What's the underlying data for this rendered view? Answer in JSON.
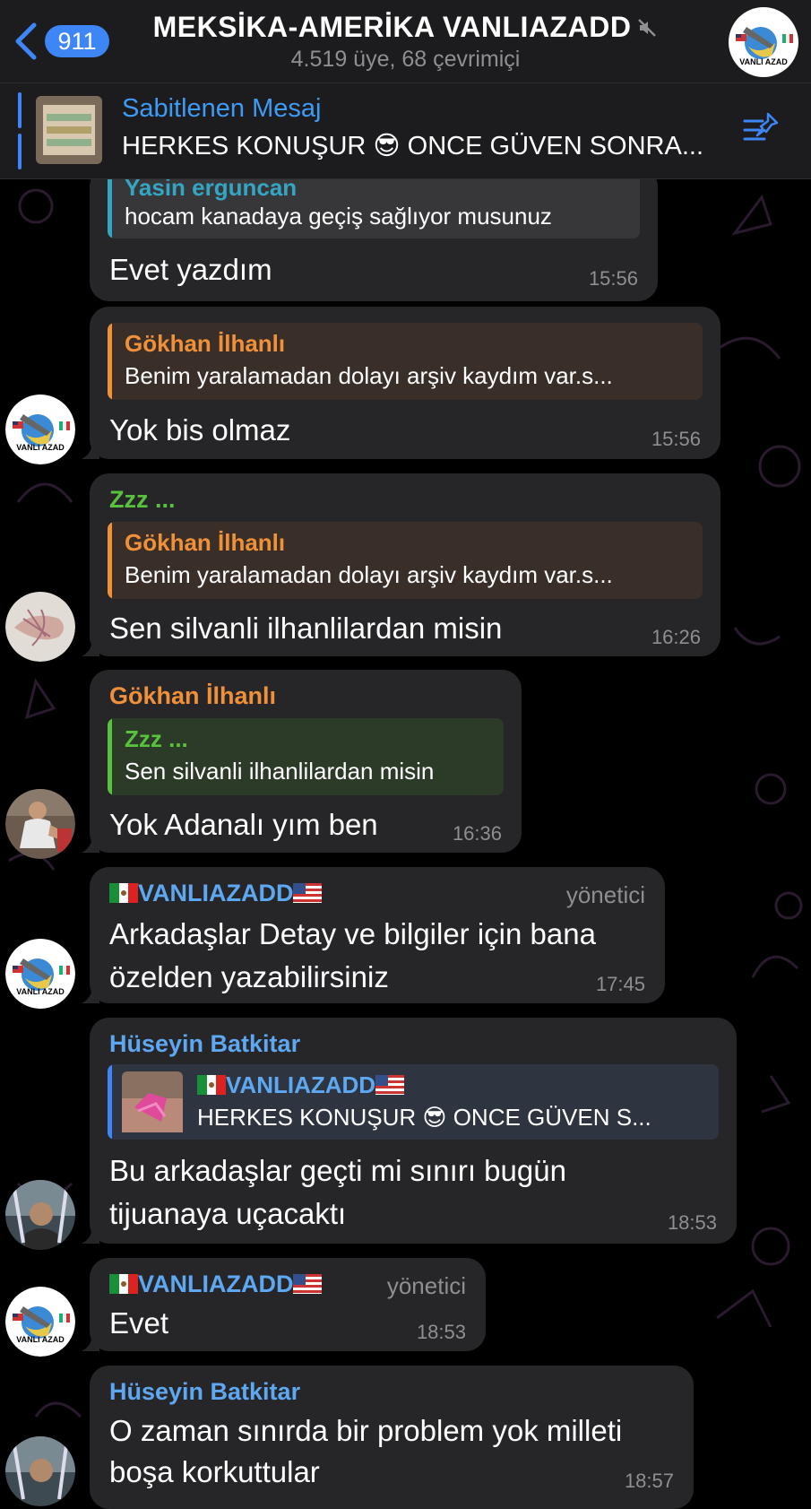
{
  "header": {
    "back_count": "911",
    "title": "MEKSİKA-AMERİKA VANLIAZADD",
    "subtitle": "4.519 üye, 68 çevrimiçi",
    "avatar_caption": "VANLI AZAD"
  },
  "pinned": {
    "title": "Sabitlenen Mesaj",
    "text": "HERKES KONUŞUR 😎 ONCE GÜVEN SONRA..."
  },
  "avatar_caption": "VANLI AZAD",
  "messages": [
    {
      "reply_name": "Yasin erguncan",
      "reply_text": "hocam kanadaya geçiş sağlıyor musunuz",
      "text": "Evet yazdım",
      "time": "15:56"
    },
    {
      "reply_name": "Gökhan İlhanlı",
      "reply_text": "Benim yaralamadan dolayı arşiv kaydım var.s...",
      "text": "Yok bis olmaz",
      "time": "15:56"
    },
    {
      "sender": "Zzz ...",
      "reply_name": "Gökhan İlhanlı",
      "reply_text": "Benim yaralamadan dolayı arşiv kaydım var.s...",
      "text": "Sen silvanli ilhanlilardan misin",
      "time": "16:26"
    },
    {
      "sender": "Gökhan İlhanlı",
      "reply_name": "Zzz ...",
      "reply_text": "Sen silvanli ilhanlilardan misin",
      "text": "Yok Adanalı yım ben",
      "time": "16:36"
    },
    {
      "sender": "VANLIAZADD",
      "role": "yönetici",
      "line1": "Arkadaşlar Detay ve bilgiler için bana",
      "line2": "özelden yazabilirsiniz",
      "time": "17:45"
    },
    {
      "sender": "Hüseyin Batkitar",
      "reply_name": "VANLIAZADD",
      "reply_text": "HERKES KONUŞUR 😎 ONCE GÜVEN S...",
      "line1": "Bu arkadaşlar geçti mi sınırı bugün",
      "line2": "tijuanaya uçacaktı",
      "time": "18:53"
    },
    {
      "sender": "VANLIAZADD",
      "role": "yönetici",
      "text": "Evet",
      "time": "18:53"
    },
    {
      "sender": "Hüseyin Batkitar",
      "line1": "O zaman sınırda bir problem yok milleti",
      "line2": "boşa korkuttular",
      "time": "18:57"
    }
  ],
  "colors": {
    "accent": "#3e86f5",
    "bubble": "#262628",
    "reply_bg": "#37373a",
    "orange": "#f0913a",
    "green": "#58c23e",
    "blue_name": "#5ea8f2",
    "teal": "#34a6c4"
  }
}
